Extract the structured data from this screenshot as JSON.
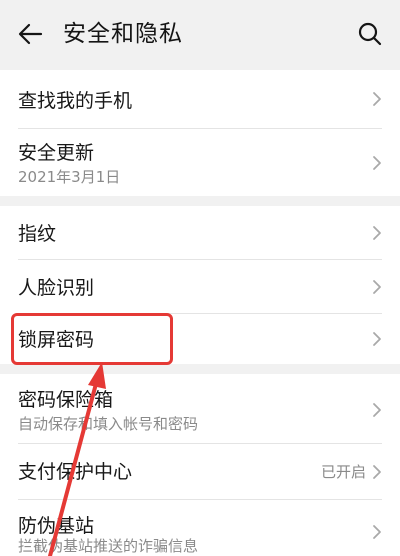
{
  "header": {
    "title": "安全和隐私"
  },
  "items": [
    {
      "label": "查找我的手机"
    },
    {
      "label": "安全更新",
      "sub": "2021年3月1日"
    },
    {
      "label": "指纹"
    },
    {
      "label": "人脸识别"
    },
    {
      "label": "锁屏密码"
    },
    {
      "label": "密码保险箱",
      "sub": "自动保存和填入帐号和密码"
    },
    {
      "label": "支付保护中心",
      "status": "已开启"
    },
    {
      "label": "防伪基站",
      "sub": "拦截伪基站推送的诈骗信息"
    }
  ],
  "annotation_color": "#e53935",
  "icons": {
    "back": "back-arrow-icon",
    "search": "search-icon",
    "chevron": "chevron-right-icon"
  }
}
